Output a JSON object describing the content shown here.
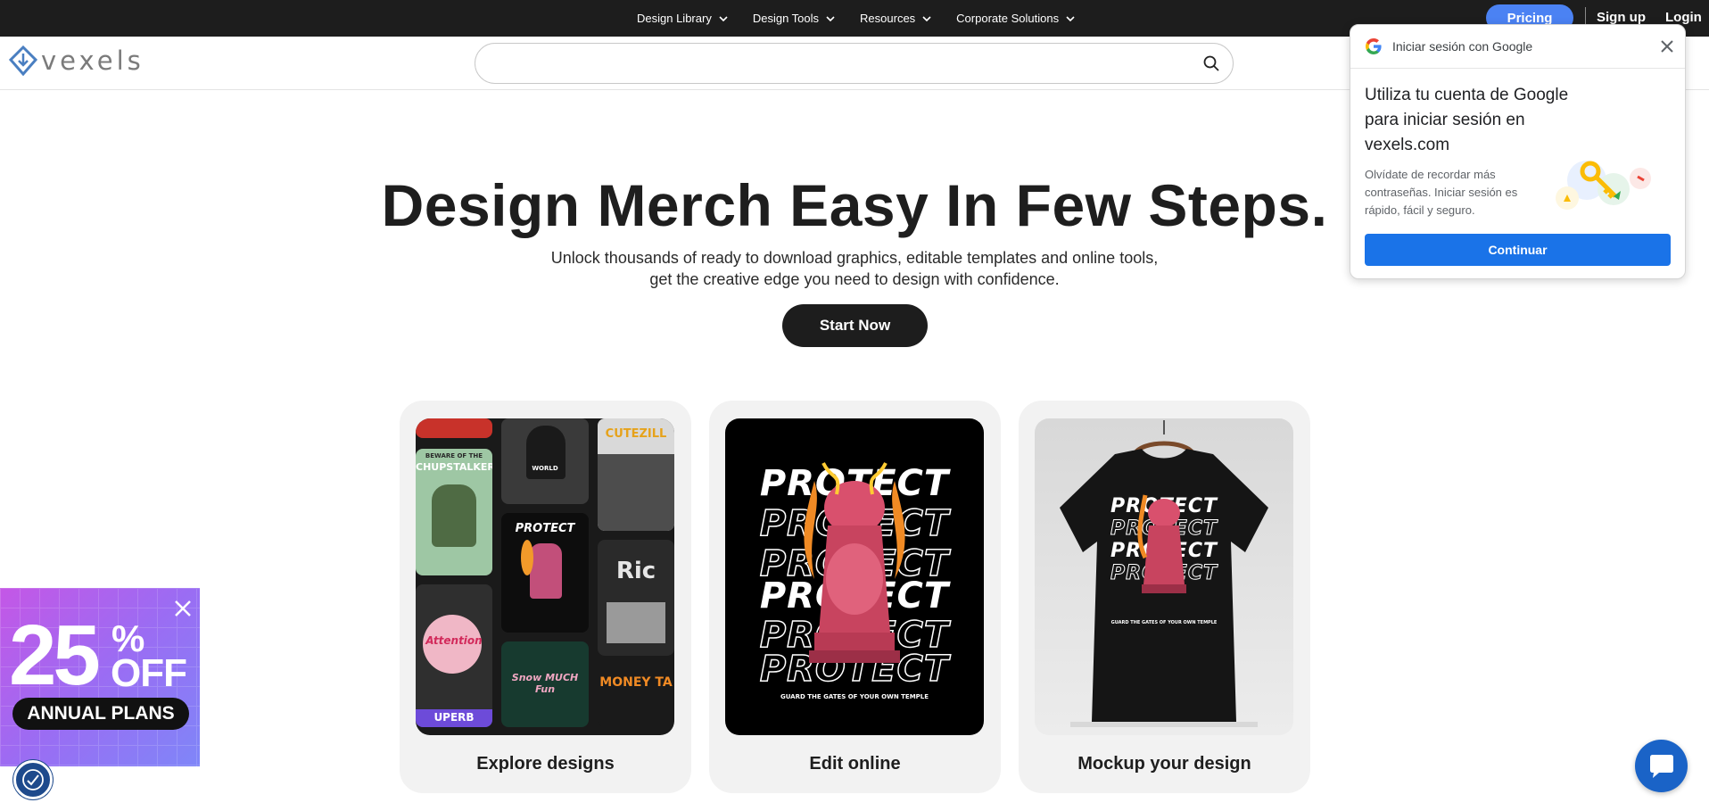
{
  "topnav": {
    "items": [
      {
        "label": "Design Library"
      },
      {
        "label": "Design Tools"
      },
      {
        "label": "Resources"
      },
      {
        "label": "Corporate Solutions"
      }
    ],
    "pricing_label": "Pricing",
    "signup_label": "Sign up",
    "login_label": "Login"
  },
  "header": {
    "logo_text": "vexels",
    "search_placeholder": "",
    "search_value": ""
  },
  "hero": {
    "title": "Design Merch Easy In Few Steps.",
    "subtitle_line1": "Unlock thousands of ready to download graphics, editable templates and online tools,",
    "subtitle_line2": "get the creative edge you need to design with confidence.",
    "cta_label": "Start Now"
  },
  "cards": [
    {
      "label": "Explore designs"
    },
    {
      "label": "Edit online"
    },
    {
      "label": "Mockup your design"
    }
  ],
  "artwork": {
    "protect_word": "PROTECT",
    "tagline": "GUARD THE GATES OF YOUR OWN TEMPLE",
    "tile_beware_top": "BEWARE OF THE",
    "tile_beware_main": "CHUPSTALKER",
    "tile_world": "WORLD",
    "tile_cutezilla": "CUTEZILL",
    "tile_attention": "Attention",
    "tile_snow": "Snow MUCH Fun",
    "tile_money": "MONEY TA",
    "tile_ric": "Ric",
    "tile_bottom": "UPERB"
  },
  "google_popup": {
    "header": "Iniciar sesión con Google",
    "title": "Utiliza tu cuenta de Google para iniciar sesión en vexels.com",
    "description": "Olvídate de recordar más contraseñas. Iniciar sesión es rápido, fácil y seguro.",
    "button_label": "Continuar"
  },
  "promo": {
    "number": "25",
    "percent": "%",
    "off": "OFF",
    "badge": "ANNUAL PLANS"
  },
  "colors": {
    "topbar": "#1d1d1d",
    "pricing": "#4b82f3",
    "google_blue": "#1a73e8",
    "chat": "#1a63c7"
  },
  "icons": {
    "search": "search-icon",
    "chevron": "chevron-down-icon",
    "close": "close-icon",
    "chat": "chat-icon",
    "accessibility": "accessibility-icon"
  }
}
